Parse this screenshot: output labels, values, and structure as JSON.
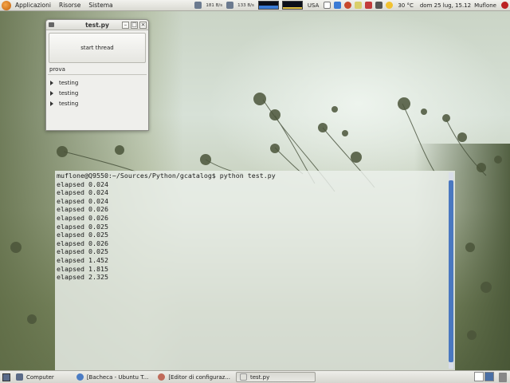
{
  "colors": {
    "panel": "#e6e6e1",
    "terminal_bg": "#ecf0ec",
    "scrollbar_thumb": "#4a78c0",
    "ubuntu_orange": "#d87a1a"
  },
  "top_panel": {
    "menus": [
      "Applicazioni",
      "Risorse",
      "Sistema"
    ],
    "net_down": "181 B/s",
    "net_up": "133 B/s",
    "keyboard_layout": "USA",
    "weather": "30 °C",
    "clock": "dom 25 lug, 15.12",
    "user": "Muflone"
  },
  "window": {
    "title": "test.py",
    "button_label": "start thread",
    "frame_label": "prova",
    "tree_items": [
      "testing",
      "testing",
      "testing"
    ]
  },
  "terminal": {
    "lines": [
      "muflone@Q9550:~/Sources/Python/gcatalog$ python test.py",
      "elapsed 0.024",
      "elapsed 0.024",
      "elapsed 0.024",
      "elapsed 0.026",
      "elapsed 0.026",
      "elapsed 0.025",
      "elapsed 0.025",
      "elapsed 0.026",
      "elapsed 0.025",
      "elapsed 1.452",
      "elapsed 1.815",
      "elapsed 2.325"
    ]
  },
  "taskbar": {
    "items": [
      {
        "label": "Computer",
        "icon": "computer-icon"
      },
      {
        "label": "[Bacheca - Ubuntu T...",
        "icon": "browser-icon"
      },
      {
        "label": "[Editor di configuraz...",
        "icon": "config-editor-icon"
      },
      {
        "label": "test.py",
        "icon": "python-window-icon"
      }
    ]
  }
}
